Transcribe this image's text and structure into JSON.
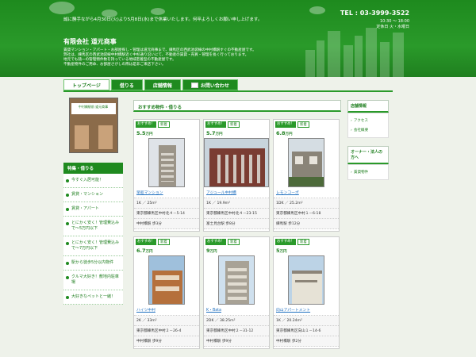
{
  "header": {
    "notice": "誠に勝手ながら4月30日(火)より5月8日(水)まで休業いたします。何卒よろしくお願い申し上げます。",
    "tel": "TEL : 03-3999-3522",
    "hours_line1": "10:30 ～ 18:00",
    "hours_line2": "定休日 火・水曜日",
    "company": "有限会社 道元商事",
    "desc_line1": "賃貸マンション・アパート・お部屋探し・管理は道元商事まで、練馬区の西武池袋線の中村橋駅すぐの不動産屋です。",
    "desc_line2": "弊社は、練馬区の西武池袋線中村橋駅近く中杉通り沿いにて、不動産の賃貸・売買・管理を長く行っております。",
    "desc_line3": "地元でも随一の管理物件数を持っている地域密着型の不動産屋です。",
    "desc_line4": "不動産物件のご用命、お部屋さがしの際は是非ご来店下さい。"
  },
  "nav": [
    "トップページ",
    "借りる",
    "店舗情報",
    "お問い合わせ"
  ],
  "left": {
    "shop_sign": "中村橋駅前 道元商事",
    "section_title": "特集・借りる",
    "items": [
      "今すぐ入居可能！",
      "賃貸・マンション",
      "賃貸・アパート",
      "とにかく安く！管理費込みで～5万円以下",
      "とにかく安く！管理費込みで～7万円以下",
      "駅から徒歩5分以内物件",
      "クルマ大好き！敷地内駐車場",
      "大好きなペットと一緒！"
    ]
  },
  "main": {
    "title": "おすすめ物件・借りる",
    "tag_rec": "おすすめ！",
    "tag_new": "新着",
    "unit": "万円",
    "cards": [
      {
        "price": "5.5",
        "name": "早船マンション",
        "layout": "1K ／ 25m²",
        "addr": "東京都練馬区中村北４－5-14",
        "station": "中村橋駅 歩3分"
      },
      {
        "price": "5.7",
        "name": "アジュール中村橋",
        "layout": "1K ／ 19.9m²",
        "addr": "東京都練馬区中村北４－23-15",
        "station": "富士見台駅 歩8分"
      },
      {
        "price": "6.8",
        "name": "レモンコーポ",
        "layout": "1DK ／ 25.2m²",
        "addr": "東京都練馬区中村１－6-18",
        "station": "練馬駅 歩12分"
      },
      {
        "price": "6.7",
        "name": "ハイツ中村",
        "layout": "2K ／ 33m²",
        "addr": "東京都練馬区中村２－26-4",
        "station": "中村橋駅 歩9分"
      },
      {
        "price": "9",
        "name": "K・Bata",
        "layout": "2DK ／ 38.25m²",
        "addr": "東京都練馬区中村２－31-12",
        "station": "中村橋駅 歩9分"
      },
      {
        "price": "5",
        "name": "向山アパートメント",
        "layout": "1K ／ 20.24m²",
        "addr": "東京都練馬区向山１－14-6",
        "station": "中村橋駅 歩2分"
      }
    ]
  },
  "right": {
    "shop_title": "店舗情報",
    "shop_items": [
      "アクセス",
      "会社概要"
    ],
    "owner_title": "オーナー・法人の方へ",
    "owner_items": [
      "賃貸物件"
    ]
  },
  "colors": {
    "brand_green": "#1f8a1f",
    "link_blue": "#1f6fbf"
  }
}
